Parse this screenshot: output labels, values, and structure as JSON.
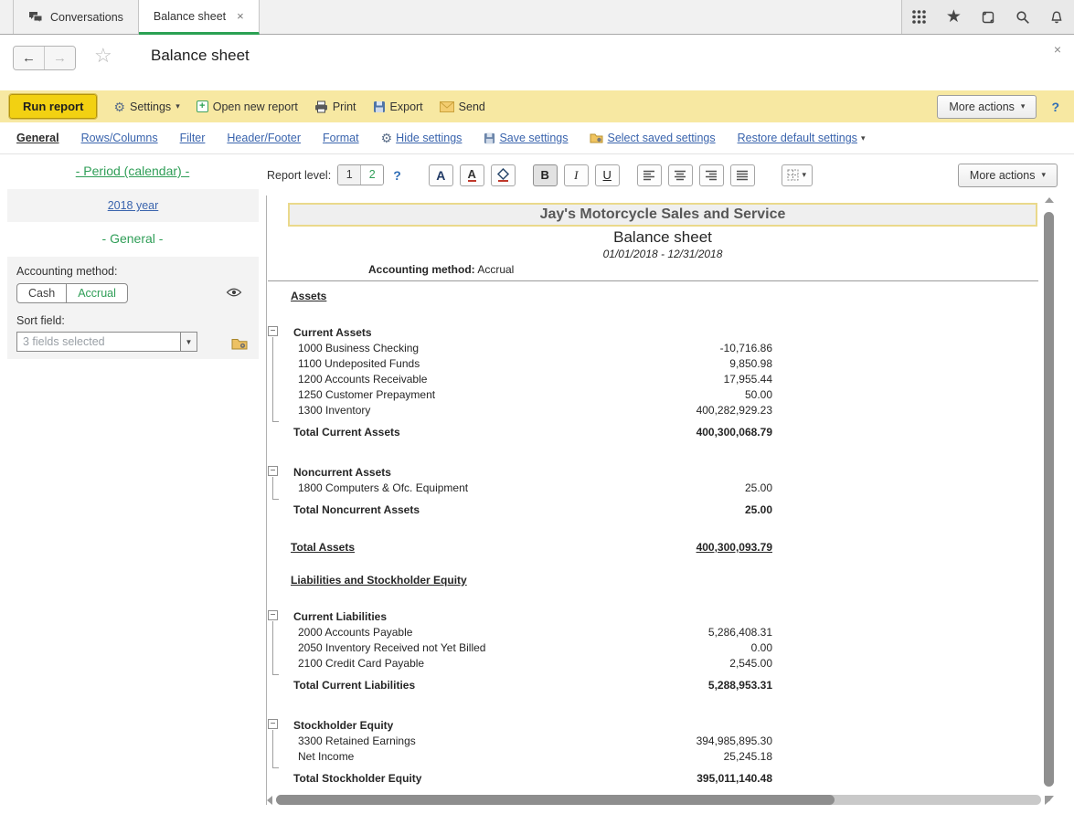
{
  "topbar": {
    "tabs": [
      {
        "label": "Conversations"
      },
      {
        "label": "Balance sheet",
        "close": "×",
        "active": true
      }
    ],
    "icons": [
      "apps-grid",
      "favorites-star",
      "history-scroll",
      "search",
      "notifications-bell"
    ]
  },
  "titlebar": {
    "title": "Balance sheet",
    "close": "×"
  },
  "command_bar": {
    "run_report": "Run report",
    "settings": "Settings",
    "open_new_report": "Open new report",
    "print": "Print",
    "export": "Export",
    "send": "Send",
    "more_actions": "More actions",
    "help": "?"
  },
  "settings_bar": {
    "tabs": [
      {
        "label": "General",
        "active": true
      },
      {
        "label": "Rows/Columns"
      },
      {
        "label": "Filter"
      },
      {
        "label": "Header/Footer"
      },
      {
        "label": "Format"
      }
    ],
    "hide_settings": "Hide settings",
    "save_settings": "Save settings",
    "select_saved_settings": "Select saved settings",
    "restore_default_settings": "Restore default settings"
  },
  "sidebar": {
    "period_link": "- Period (calendar) -",
    "period_value": "2018 year",
    "general_header": "- General -",
    "accounting_method_label": "Accounting method:",
    "accounting_method_options": [
      "Cash",
      "Accrual"
    ],
    "accounting_method_selected": "Accrual",
    "sort_field_label": "Sort field:",
    "sort_field_value": "3 fields selected"
  },
  "report_toolbar": {
    "report_level_label": "Report level:",
    "levels": [
      "1",
      "2"
    ],
    "active_level": "2",
    "help": "?",
    "more_actions": "More actions",
    "format_buttons": [
      "font",
      "font-color",
      "fill-color",
      "bold",
      "italic",
      "underline",
      "align-left",
      "align-center",
      "align-right",
      "align-justify",
      "borders"
    ]
  },
  "report": {
    "company": "Jay's Motorcycle Sales and Service",
    "title": "Balance sheet",
    "period": "01/01/2018 - 12/31/2018",
    "method_label": "Accounting method:",
    "method_value": "Accrual",
    "sections": [
      {
        "heading": "Assets",
        "groups": [
          {
            "name": "Current Assets",
            "rows": [
              {
                "label": "1000 Business Checking",
                "amount": "-10,716.86"
              },
              {
                "label": "1100 Undeposited Funds",
                "amount": "9,850.98"
              },
              {
                "label": "1200 Accounts Receivable",
                "amount": "17,955.44"
              },
              {
                "label": "1250 Customer Prepayment",
                "amount": "50.00"
              },
              {
                "label": "1300 Inventory",
                "amount": "400,282,929.23"
              }
            ],
            "total": {
              "label": "Total Current Assets",
              "amount": "400,300,068.79"
            }
          },
          {
            "name": "Noncurrent Assets",
            "rows": [
              {
                "label": "1800 Computers & Ofc. Equipment",
                "amount": "25.00"
              }
            ],
            "total": {
              "label": "Total Noncurrent Assets",
              "amount": "25.00"
            }
          }
        ],
        "grand_total": {
          "label": "Total Assets",
          "amount": "400,300,093.79"
        }
      },
      {
        "heading": "Liabilities and Stockholder Equity",
        "groups": [
          {
            "name": "Current Liabilities",
            "rows": [
              {
                "label": "2000 Accounts Payable",
                "amount": "5,286,408.31"
              },
              {
                "label": "2050 Inventory Received not Yet Billed",
                "amount": "0.00"
              },
              {
                "label": "2100 Credit Card Payable",
                "amount": "2,545.00"
              }
            ],
            "total": {
              "label": "Total Current Liabilities",
              "amount": "5,288,953.31"
            }
          },
          {
            "name": "Stockholder Equity",
            "rows": [
              {
                "label": "3300 Retained Earnings",
                "amount": "394,985,895.30"
              },
              {
                "label": "Net Income",
                "amount": "25,245.18"
              }
            ],
            "total": {
              "label": "Total Stockholder Equity",
              "amount": "395,011,140.48"
            }
          }
        ]
      }
    ]
  },
  "colors": {
    "accent_green": "#2ba153",
    "link_blue": "#3a64ad",
    "toolbar_yellow": "#f7e8a2",
    "run_button_yellow": "#f2d112",
    "selection_border": "#ead98b"
  }
}
